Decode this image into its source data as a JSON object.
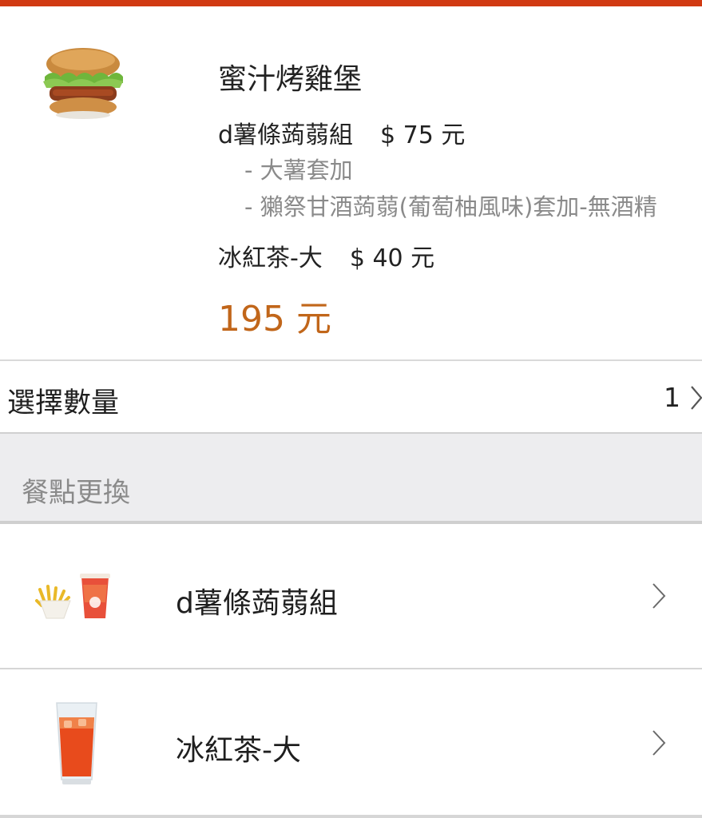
{
  "product": {
    "title": "蜜汁烤雞堡",
    "combo_name": "d薯條蒟蒻組",
    "combo_price": "$ 75 元",
    "combo_options": [
      "- 大薯套加",
      "- 獺祭甘酒蒟蒻(葡萄柚風味)套加-無酒精"
    ],
    "drink_name": "冰紅茶-大",
    "drink_price": "$ 40 元",
    "total": "195 元"
  },
  "quantity": {
    "label": "選擇數量",
    "value": "1"
  },
  "section": {
    "title": "餐點更換"
  },
  "items": [
    {
      "label": "d薯條蒟蒻組",
      "icon": "fries-and-drink-image"
    },
    {
      "label": "冰紅茶-大",
      "icon": "iced-tea-image"
    }
  ],
  "colors": {
    "accent_bar": "#d13a12",
    "price_total": "#c1661a",
    "muted_text": "#8a8a8a",
    "section_bg": "#ededef"
  }
}
